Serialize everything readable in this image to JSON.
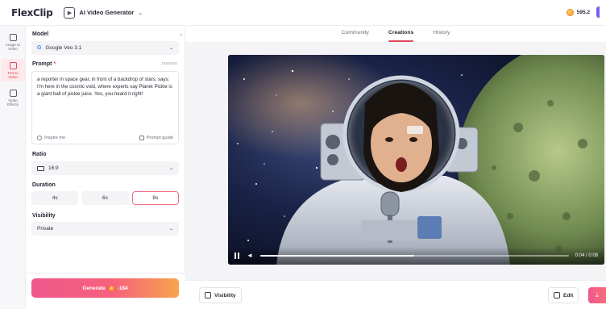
{
  "header": {
    "logo_text": "FlexClip",
    "tool_label": "AI Video Generator",
    "credits": "595.2"
  },
  "rail": {
    "items": [
      {
        "label": "Image to\nVideo",
        "active": false
      },
      {
        "label": "Text to\nVideo",
        "active": true
      },
      {
        "label": "Video\nEffects",
        "active": false
      }
    ]
  },
  "settings": {
    "model_title": "Model",
    "model_value": "Google Veo 3.1",
    "prompt_title": "Prompt",
    "prompt_required_mark": "*",
    "prompt_counter": "155/5000",
    "prompt_text": "a reporter in space gear, in front of a backdrop of stars, says: I'm here in the cosmic void, where experts say Planet Pickle is a giant ball of pickle juice. Yes, you heard it right!",
    "inspire_label": "Inspire me",
    "prompt_guide_label": "Prompt guide",
    "ratio_title": "Ratio",
    "ratio_value": "16:9",
    "duration_title": "Duration",
    "durations": [
      "4s",
      "6s",
      "8s"
    ],
    "selected_duration": "8s",
    "visibility_title": "Visibility",
    "visibility_value": "Private",
    "generate_label": "Generate",
    "generate_cost": "-184"
  },
  "main": {
    "tabs": [
      "Community",
      "Creations",
      "History"
    ],
    "active_tab": "Creations",
    "player": {
      "time": "0:04 / 0:08",
      "progress_fraction": 0.5
    },
    "visibility_button": "Visibility",
    "edit_button": "Edit"
  },
  "colors": {
    "accent": "#e2455c",
    "generate_gradient_start": "#f0578d",
    "generate_gradient_end": "#f7a44c"
  }
}
